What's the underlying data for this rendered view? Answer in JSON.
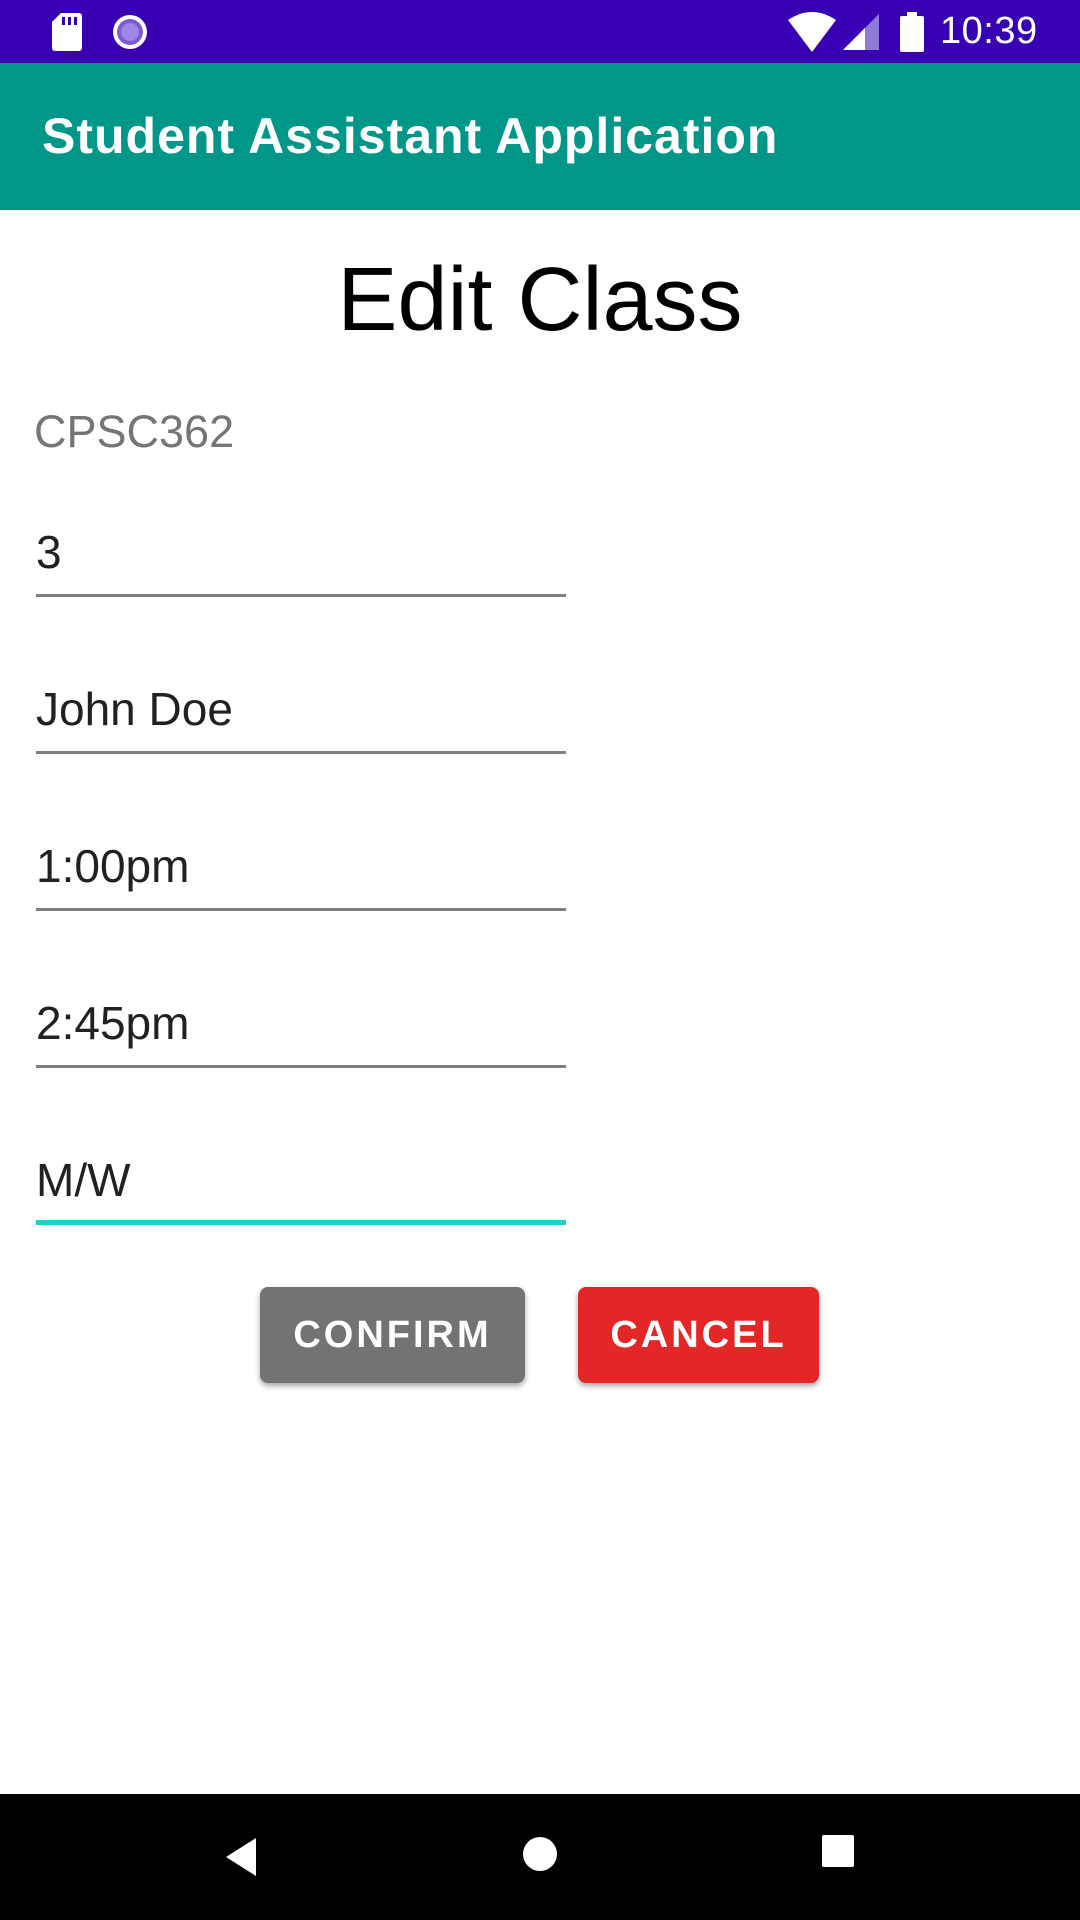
{
  "status_bar": {
    "time": "10:39",
    "icons": [
      "sd-card-icon",
      "sync-icon",
      "wifi-icon",
      "signal-icon",
      "battery-icon"
    ]
  },
  "app_bar": {
    "title": "Student Assistant Application",
    "color": "#009688"
  },
  "page": {
    "title": "Edit Class",
    "course_code": "CPSC362"
  },
  "form": {
    "units": "3",
    "instructor": "John Doe",
    "start_time": "1:00pm",
    "end_time": "2:45pm",
    "days": "M/W"
  },
  "buttons": {
    "confirm_label": "CONFIRM",
    "cancel_label": "CANCEL"
  },
  "colors": {
    "status_bar": "#3700b3",
    "accent": "#1ad1c5",
    "confirm": "#737373",
    "cancel": "#e32626"
  },
  "nav_bar": {
    "icons": [
      "back-icon",
      "home-icon",
      "recents-icon"
    ]
  }
}
